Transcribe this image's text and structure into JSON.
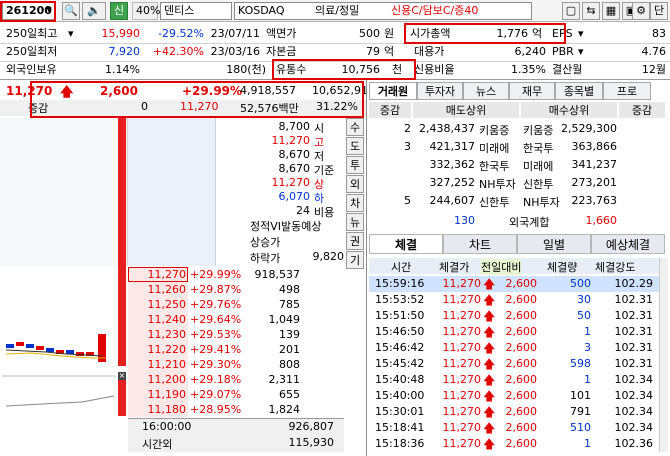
{
  "toolbar": {
    "code": "261200",
    "badge_new": "신",
    "percent": "40%",
    "name": "덴티스",
    "market": "KOSDAQ",
    "sector": "의료/정밀",
    "tags": "신용C/담보C/증40",
    "btn_settings": "⚙",
    "btn_dan": "단"
  },
  "info": {
    "r1": {
      "l1": "250일최고",
      "v1": "15,990",
      "p1": "-29.52%",
      "d1": "23/07/11",
      "l2": "액면가",
      "v2": "500",
      "u2": "원",
      "l3": "시가총액",
      "v3": "1,776",
      "u3": "억",
      "l4": "EPS",
      "v4": "83"
    },
    "r2": {
      "l1": "250일최저",
      "v1": "7,920",
      "p1": "+42.30%",
      "d1": "23/03/16",
      "l2": "자본금",
      "v2": "79",
      "u2": "억",
      "l3": "대용가",
      "v3": "6,240",
      "l4": "PBR",
      "v4": "4.76"
    },
    "r3": {
      "l1": "외국인보유",
      "v1": "1.14%",
      "v1b": "180(천)",
      "l2": "유통수",
      "v2": "10,756",
      "u2": "천",
      "l3": "신용비율",
      "v3": "1.35%",
      "l4": "결산월",
      "v4": "12월"
    }
  },
  "quote": {
    "price": "11,270",
    "change": "2,600",
    "rate": "+29.99%",
    "volume": "4,918,557",
    "prev_volume": "10,652,91",
    "label_change": "증감",
    "change_qty": "0",
    "price2": "11,270",
    "amount": "52,576백만",
    "ratio": "31.22%"
  },
  "summary": {
    "items": [
      {
        "v": "8,700",
        "l": "시",
        "cls": ""
      },
      {
        "v": "11,270",
        "l": "고",
        "cls": "red"
      },
      {
        "v": "8,670",
        "l": "저",
        "cls": ""
      },
      {
        "v": "8,670",
        "l": "기준",
        "cls": ""
      },
      {
        "v": "11,270",
        "l": "상",
        "cls": "red"
      },
      {
        "v": "6,070",
        "l": "하",
        "cls": "blue"
      },
      {
        "v": "24",
        "l": "비용",
        "cls": ""
      }
    ],
    "notice1": "정적VI발동예상",
    "notice2": "상승가",
    "notice3": "하락가",
    "notice3_v": "9,820"
  },
  "vtabs": [
    "수",
    "도",
    "투",
    "외",
    "차",
    "뉴",
    "권",
    "기"
  ],
  "orderbook": [
    {
      "price": "11,270",
      "rate": "+29.99%",
      "qty": "918,537",
      "sel": true
    },
    {
      "price": "11,260",
      "rate": "+29.87%",
      "qty": "498"
    },
    {
      "price": "11,250",
      "rate": "+29.76%",
      "qty": "785"
    },
    {
      "price": "11,240",
      "rate": "+29.64%",
      "qty": "1,049"
    },
    {
      "price": "11,230",
      "rate": "+29.53%",
      "qty": "139"
    },
    {
      "price": "11,220",
      "rate": "+29.41%",
      "qty": "201"
    },
    {
      "price": "11,210",
      "rate": "+29.30%",
      "qty": "808"
    },
    {
      "price": "11,200",
      "rate": "+29.18%",
      "qty": "2,311"
    },
    {
      "price": "11,190",
      "rate": "+29.07%",
      "qty": "655"
    },
    {
      "price": "11,180",
      "rate": "+28.95%",
      "qty": "1,824"
    }
  ],
  "ob_footer": {
    "time": "16:00:00",
    "vol": "926,807",
    "label": "시간외",
    "vol2": "115,930"
  },
  "broker_tabs": [
    "거래원",
    "투자자",
    "뉴스",
    "재무",
    "종목별",
    "프로"
  ],
  "broker": {
    "headers": [
      "증감",
      "매도상위",
      "매수상위",
      "증감"
    ],
    "rows": [
      {
        "d1": "2",
        "sq": "2,438,437",
        "sn": "키움증",
        "bn": "키움증",
        "bq": "2,529,300"
      },
      {
        "d1": "3",
        "sq": "421,317",
        "sn": "미래에",
        "bn": "한국투",
        "bq": "363,866"
      },
      {
        "d1": "",
        "sq": "332,362",
        "sn": "한국투",
        "bn": "미래에",
        "bq": "341,237"
      },
      {
        "d1": "",
        "sq": "327,252",
        "sn": "NH투자",
        "bn": "신한투",
        "bq": "273,201"
      },
      {
        "d1": "5",
        "sq": "244,607",
        "sn": "신한투",
        "bn": "NH투자",
        "bq": "223,763"
      }
    ],
    "foreign_sell": "130",
    "foreign_label": "외국계합",
    "foreign_buy": "1,660"
  },
  "trade_tabs": [
    "체결",
    "차트",
    "일별",
    "예상체결"
  ],
  "trades": {
    "headers": [
      "시간",
      "체결가",
      "전일대비",
      "체결량",
      "체결강도"
    ],
    "rows": [
      {
        "t": "15:59:16",
        "p": "11,270",
        "c": "2,600",
        "q": "500",
        "s": "102.29",
        "qc": "blue",
        "hl": true
      },
      {
        "t": "15:53:52",
        "p": "11,270",
        "c": "2,600",
        "q": "30",
        "s": "102.31",
        "qc": "blue"
      },
      {
        "t": "15:51:50",
        "p": "11,270",
        "c": "2,600",
        "q": "50",
        "s": "102.31",
        "qc": "blue"
      },
      {
        "t": "15:46:50",
        "p": "11,270",
        "c": "2,600",
        "q": "1",
        "s": "102.31",
        "qc": "blue"
      },
      {
        "t": "15:46:42",
        "p": "11,270",
        "c": "2,600",
        "q": "3",
        "s": "102.31",
        "qc": "blue"
      },
      {
        "t": "15:45:42",
        "p": "11,270",
        "c": "2,600",
        "q": "598",
        "s": "102.31",
        "qc": "blue"
      },
      {
        "t": "15:40:48",
        "p": "11,270",
        "c": "2,600",
        "q": "1",
        "s": "102.34",
        "qc": "blue"
      },
      {
        "t": "15:40:00",
        "p": "11,270",
        "c": "2,600",
        "q": "101",
        "s": "102.34",
        "qc": ""
      },
      {
        "t": "15:30:01",
        "p": "11,270",
        "c": "2,600",
        "q": "791",
        "s": "102.34",
        "qc": ""
      },
      {
        "t": "15:18:41",
        "p": "11,270",
        "c": "2,600",
        "q": "510",
        "s": "102.34",
        "qc": "blue"
      },
      {
        "t": "15:18:36",
        "p": "11,270",
        "c": "2,600",
        "q": "1",
        "s": "102.36",
        "qc": "blue"
      }
    ]
  },
  "colors": {
    "up": "#e00000",
    "down": "#0033cc",
    "accent": "#e00000",
    "panel": "#eef3f8"
  }
}
